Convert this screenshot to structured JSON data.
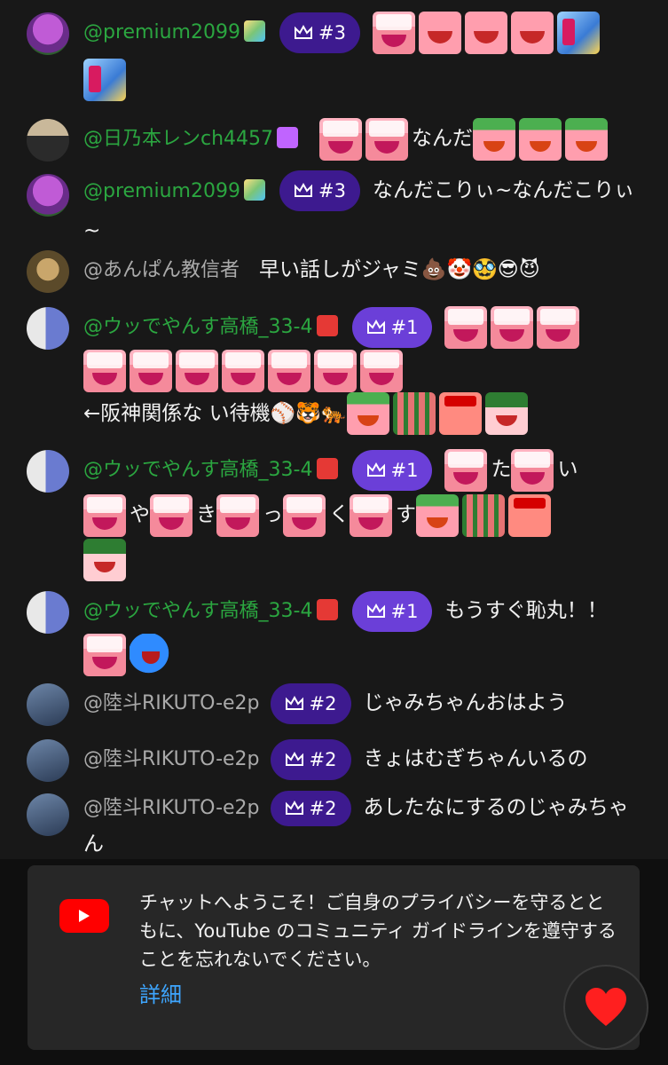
{
  "chat": {
    "messages": [
      {
        "author": "@premium2099",
        "rank": "#3",
        "text": "",
        "emotes": [
          "wait",
          "jime",
          "jime",
          "jime",
          "buri",
          "buri"
        ],
        "badge_color": "#7cc576"
      },
      {
        "author": "@日乃本レンch4457",
        "rank": "",
        "text": "なんだ",
        "emotes_before": [
          "wait",
          "wait"
        ],
        "emotes": [
          "kori",
          "kori",
          "kori"
        ],
        "badge_color": "#c064ff"
      },
      {
        "author": "@premium2099",
        "rank": "#3",
        "text": "なんだこりぃ~なんだこりぃ~",
        "badge_color": "#7cc576"
      },
      {
        "author": "@あんぱん教信者",
        "rank": "",
        "text": "早い話しがジャミ",
        "emoji": "💩🤡🥸😎😈"
      },
      {
        "author": "@ウッでやんす高橋_33-4",
        "rank": "#1",
        "text_after": "←阪神関係な い待機",
        "emoji": "⚾🐯🐅",
        "badge_color": "#e53935"
      },
      {
        "author": "@ウッでやんす高橋_33-4",
        "rank": "#1",
        "chars": [
          "た",
          "い",
          "や",
          "き",
          "っ",
          "く",
          "す"
        ],
        "badge_color": "#e53935"
      },
      {
        "author": "@ウッでやんす高橋_33-4",
        "rank": "#1",
        "text": "もうすぐ恥丸！！",
        "badge_color": "#e53935"
      },
      {
        "author": "@陸斗RIKUTO-e2p",
        "rank": "#2",
        "text": "じゃみちゃんおはよう"
      },
      {
        "author": "@陸斗RIKUTO-e2p",
        "rank": "#2",
        "text": "きょはむぎちゃんいるの"
      },
      {
        "author": "@陸斗RIKUTO-e2p",
        "rank": "#2",
        "text": "あしたなにするのじゃみちゃん"
      }
    ]
  },
  "welcome": {
    "text": "チャットへようこそ！ご自身のプライバシーを守るとともに、YouTube のコミュニティ ガイドラインを遵守することを忘れないでください。",
    "link": "詳細"
  },
  "colors": {
    "author_green": "#2ba640",
    "rank_dark": "#3d1a8f",
    "rank_bright": "#6b3fd8",
    "link": "#3ea6ff",
    "yt_red": "#ff0000"
  },
  "icons": {
    "crown": "crown-icon",
    "heart": "heart-icon",
    "youtube": "youtube-logo-icon"
  }
}
